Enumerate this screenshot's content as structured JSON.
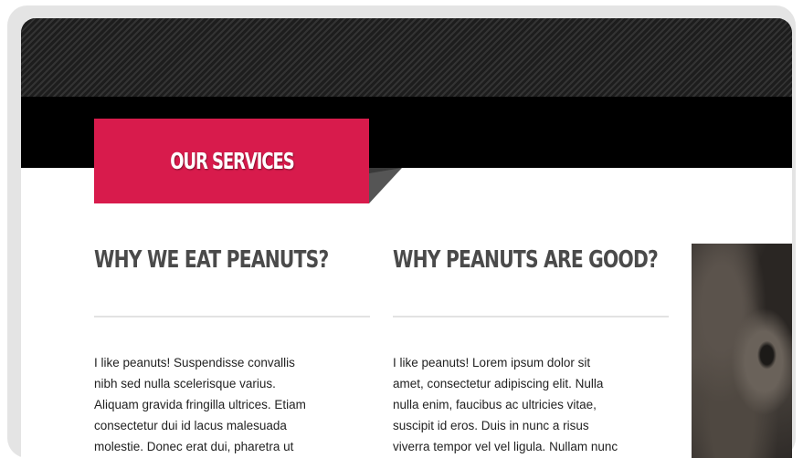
{
  "services": {
    "title": "OUR SERVICES"
  },
  "columns": [
    {
      "heading": "WHY WE EAT PEANUTS?",
      "body": "I like peanuts! Suspendisse convallis\nnibh sed nulla scelerisque varius.\nAliquam gravida fringilla ultrices. Etiam\nconsectetur dui id lacus malesuada\nmolestie. Donec erat dui, pharetra ut"
    },
    {
      "heading": "WHY PEANUTS ARE GOOD?",
      "body": "I like peanuts! Lorem ipsum dolor sit\namet, consectetur adipiscing elit. Nulla\nnulla enim, faucibus ac ultricies vitae,\nsuscipit id eros. Duis in nunc a risus\nviverra tempor vel vel ligula. Nullam nunc"
    }
  ],
  "colors": {
    "accent": "#d81b4c",
    "header_band": "#000000",
    "pattern": "#262626",
    "heading_text": "#4a4a4a",
    "frame": "#e4e4e4"
  },
  "icons": {
    "tab_fold": "fold-triangle-icon"
  }
}
